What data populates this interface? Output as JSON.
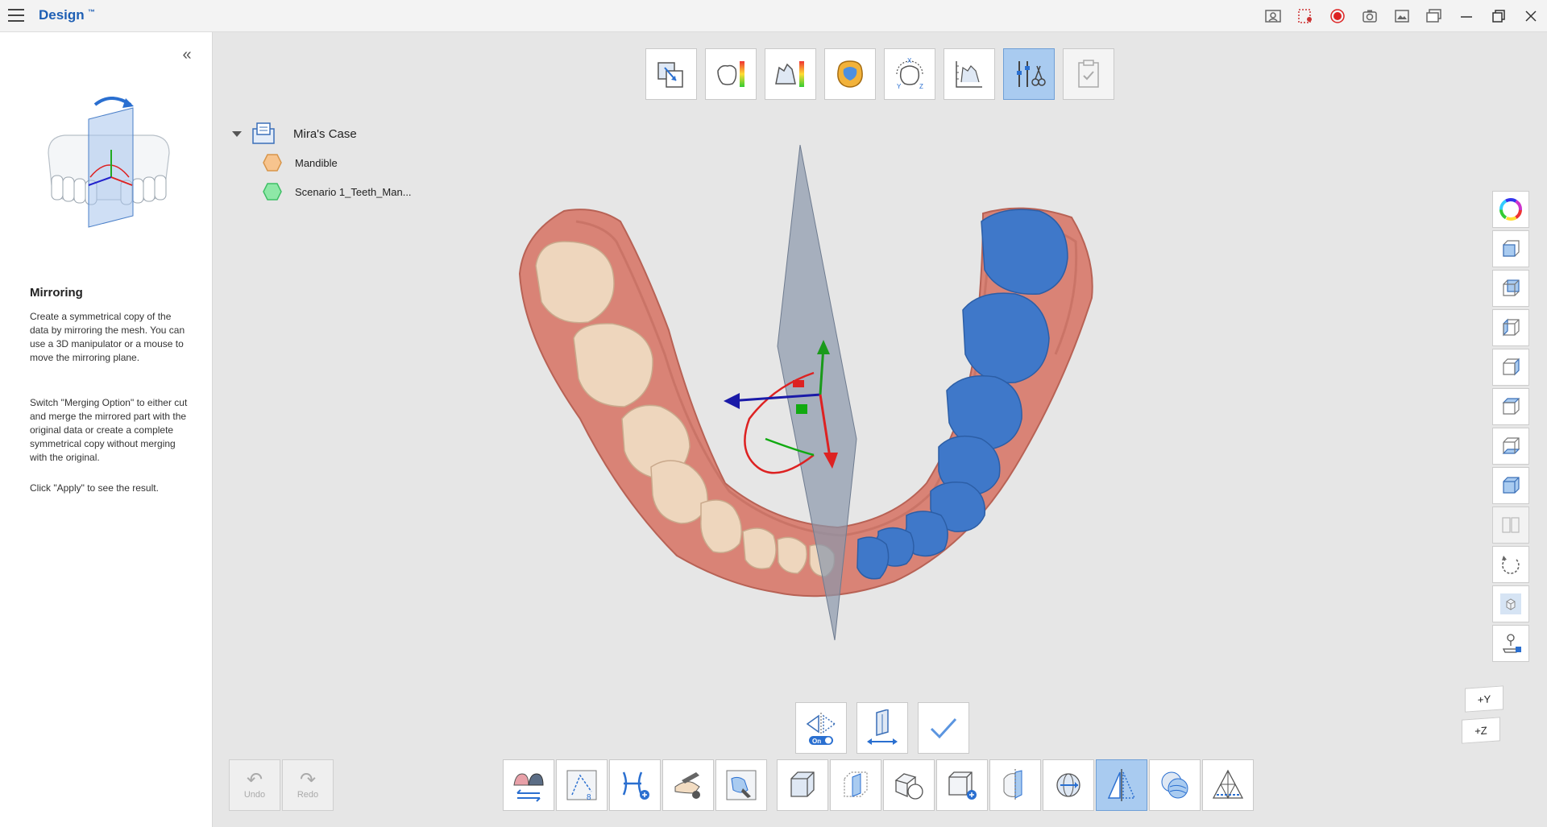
{
  "app": {
    "title": "Design",
    "badge": "™"
  },
  "window_controls": [
    "help-guide-icon",
    "screen-record-area-icon",
    "record-icon",
    "camera-icon",
    "image-capture-icon",
    "gallery-icon",
    "minimize-icon",
    "restore-icon",
    "close-icon"
  ],
  "left_panel": {
    "collapse_glyph": "«",
    "title": "Mirroring",
    "paragraphs": [
      "Create a symmetrical copy of the data by mirroring the mesh. You can use a 3D manipulator or a mouse to move the mirroring plane.",
      "Switch \"Merging Option\" to either cut and merge the mirrored part with the original data or create a complete symmetrical copy without merging with the original.",
      "Click \"Apply\" to see the result."
    ]
  },
  "top_toolbar": [
    {
      "icon": "align-icon",
      "state": "normal"
    },
    {
      "icon": "crown-thickness-icon",
      "state": "normal"
    },
    {
      "icon": "distance-map-icon",
      "state": "normal"
    },
    {
      "icon": "occlusion-icon",
      "state": "normal"
    },
    {
      "icon": "xyz-orientation-icon",
      "state": "normal"
    },
    {
      "icon": "measure-icon",
      "state": "normal"
    },
    {
      "icon": "edit-tools-icon",
      "state": "active"
    },
    {
      "icon": "checklist-icon",
      "state": "disabled"
    }
  ],
  "tree": {
    "case": "Mira's Case",
    "items": [
      {
        "label": "Mandible",
        "color": "#f7c48e",
        "stroke": "#d8954a"
      },
      {
        "label": "Scenario 1_Teeth_Man...",
        "color": "#8ee8a7",
        "stroke": "#3fbf66"
      }
    ]
  },
  "right_toolbar": [
    "color-wheel-icon",
    "view-front-icon",
    "view-back-icon",
    "view-left-icon",
    "view-right-icon",
    "view-top-icon",
    "view-bottom-icon",
    "view-iso-icon",
    "split-view-icon",
    "reset-view-icon",
    "solid-cube-icon",
    "scanner-icon"
  ],
  "axis_widget": {
    "y": "+Y",
    "z": "+Z"
  },
  "option_toolbar": [
    {
      "icon": "merge-option-icon",
      "toggle": "On"
    },
    {
      "icon": "flip-plane-icon"
    },
    {
      "icon": "apply-check-icon"
    }
  ],
  "undo_redo": {
    "undo": "Undo",
    "redo": "Redo"
  },
  "bottom_toolbar": [
    [
      "arch-swap-icon",
      "trim-icon",
      "add-model-icon",
      "sculpt-icon",
      "fill-icon"
    ],
    [
      "cube-view-icon",
      "section-view-icon",
      "mesh-combine-icon",
      "add-cube-icon",
      "plane-cut-icon",
      "split-sphere-icon",
      "mirroring-icon",
      "smooth-sphere-icon",
      "triangle-mesh-icon"
    ]
  ],
  "bottom_toolbar_active": "mirroring-icon"
}
